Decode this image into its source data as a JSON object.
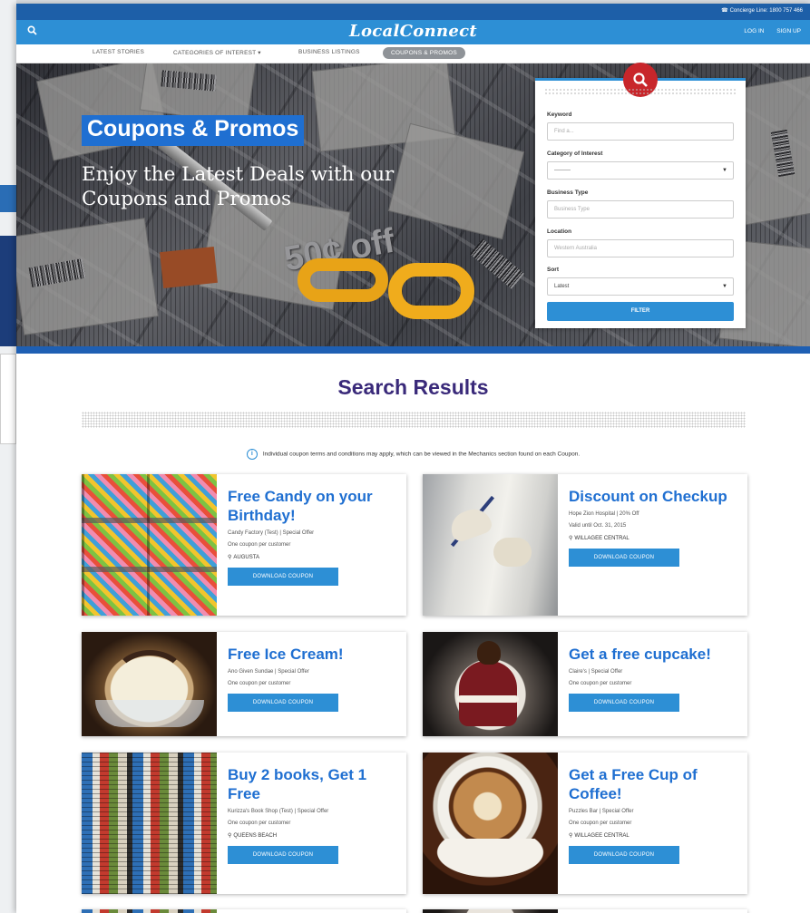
{
  "concierge": {
    "icon": "phone-icon",
    "text": "Concierge Line: 1800 757 466"
  },
  "header": {
    "logo": "LocalConnect",
    "login": "LOG IN",
    "signup": "SIGN UP"
  },
  "nav": {
    "items": [
      {
        "label": "LATEST STORIES"
      },
      {
        "label": "CATEGORIES OF INTEREST ▾"
      },
      {
        "label": "BUSINESS LISTINGS"
      },
      {
        "label": "COUPONS & PROMOS",
        "active": true
      }
    ]
  },
  "hero": {
    "title": "Coupons & Promos",
    "subtitle": "Enjoy the Latest Deals with our Coupons and Promos",
    "fifty_text": "50¢ off"
  },
  "filter": {
    "keyword_label": "Keyword",
    "keyword_placeholder": "Find a...",
    "category_label": "Category of Interest",
    "category_value": "---------",
    "business_type_label": "Business Type",
    "business_type_placeholder": "Business Type",
    "location_label": "Location",
    "location_value": "Western Australia",
    "sort_label": "Sort",
    "sort_value": "Latest",
    "button": "FILTER"
  },
  "results": {
    "title": "Search Results",
    "notice": "Individual coupon terms and conditions may apply, which can be viewed in the Mechanics section found on each Coupon."
  },
  "coupons": [
    {
      "title": "Free Candy on your Birthday!",
      "meta": "Candy Factory (Test)  |  Special Offer",
      "meta2": "One coupon per customer",
      "location": "AUGUSTA",
      "button": "DOWNLOAD COUPON"
    },
    {
      "title": "Discount on Checkup",
      "meta": "Hope Zion Hospital  |  20% Off",
      "meta2": "Valid until Oct. 31, 2015",
      "location": "WILLAGEE CENTRAL",
      "button": "DOWNLOAD COUPON"
    },
    {
      "title": "Free Ice Cream!",
      "meta": "Ano Given Sundae  |  Special Offer",
      "meta2": "One coupon per customer",
      "location": "",
      "button": "DOWNLOAD COUPON"
    },
    {
      "title": "Get a free cupcake!",
      "meta": "Claire's  |  Special Offer",
      "meta2": "One coupon per customer",
      "location": "",
      "button": "DOWNLOAD COUPON"
    },
    {
      "title": "Buy 2 books, Get 1 Free",
      "meta": "Kurizza's Book Shop (Test)  |  Special Offer",
      "meta2": "One coupon per customer",
      "location": "QUEENS BEACH",
      "button": "DOWNLOAD COUPON"
    },
    {
      "title": "Get a Free Cup of Coffee!",
      "meta": "Puzzles Bar  |  Special Offer",
      "meta2": "One coupon per customer",
      "location": "WILLAGEE CENTRAL",
      "button": "DOWNLOAD COUPON"
    }
  ]
}
